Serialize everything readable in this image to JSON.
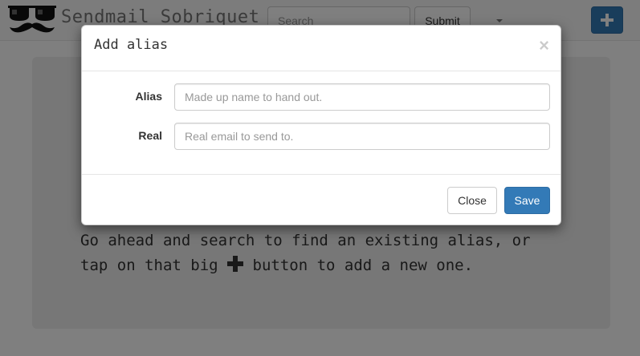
{
  "navbar": {
    "brand": "Sendmail Sobriquet",
    "search_placeholder": "Search",
    "submit_label": "Submit",
    "logo_icon": "glasses-mustache-icon",
    "add_icon": "plus-icon",
    "dropdown_icon": "caret-down-icon"
  },
  "jumbotron": {
    "peek_text": "",
    "lead_part1": "Go ahead and search to find an existing alias, or tap on that big",
    "lead_icon": "plus-icon",
    "lead_part2": "button to add a new one."
  },
  "modal": {
    "title": "Add alias",
    "close_icon": "×",
    "fields": [
      {
        "label": "Alias",
        "placeholder": "Made up name to hand out."
      },
      {
        "label": "Real",
        "placeholder": "Real email to send to."
      }
    ],
    "close_label": "Close",
    "save_label": "Save"
  },
  "colors": {
    "primary": "#337ab7",
    "navbar_bg": "#f8f8f8",
    "jumbotron_bg": "#eeeeee",
    "backdrop": "rgba(0,0,0,0.5)"
  }
}
